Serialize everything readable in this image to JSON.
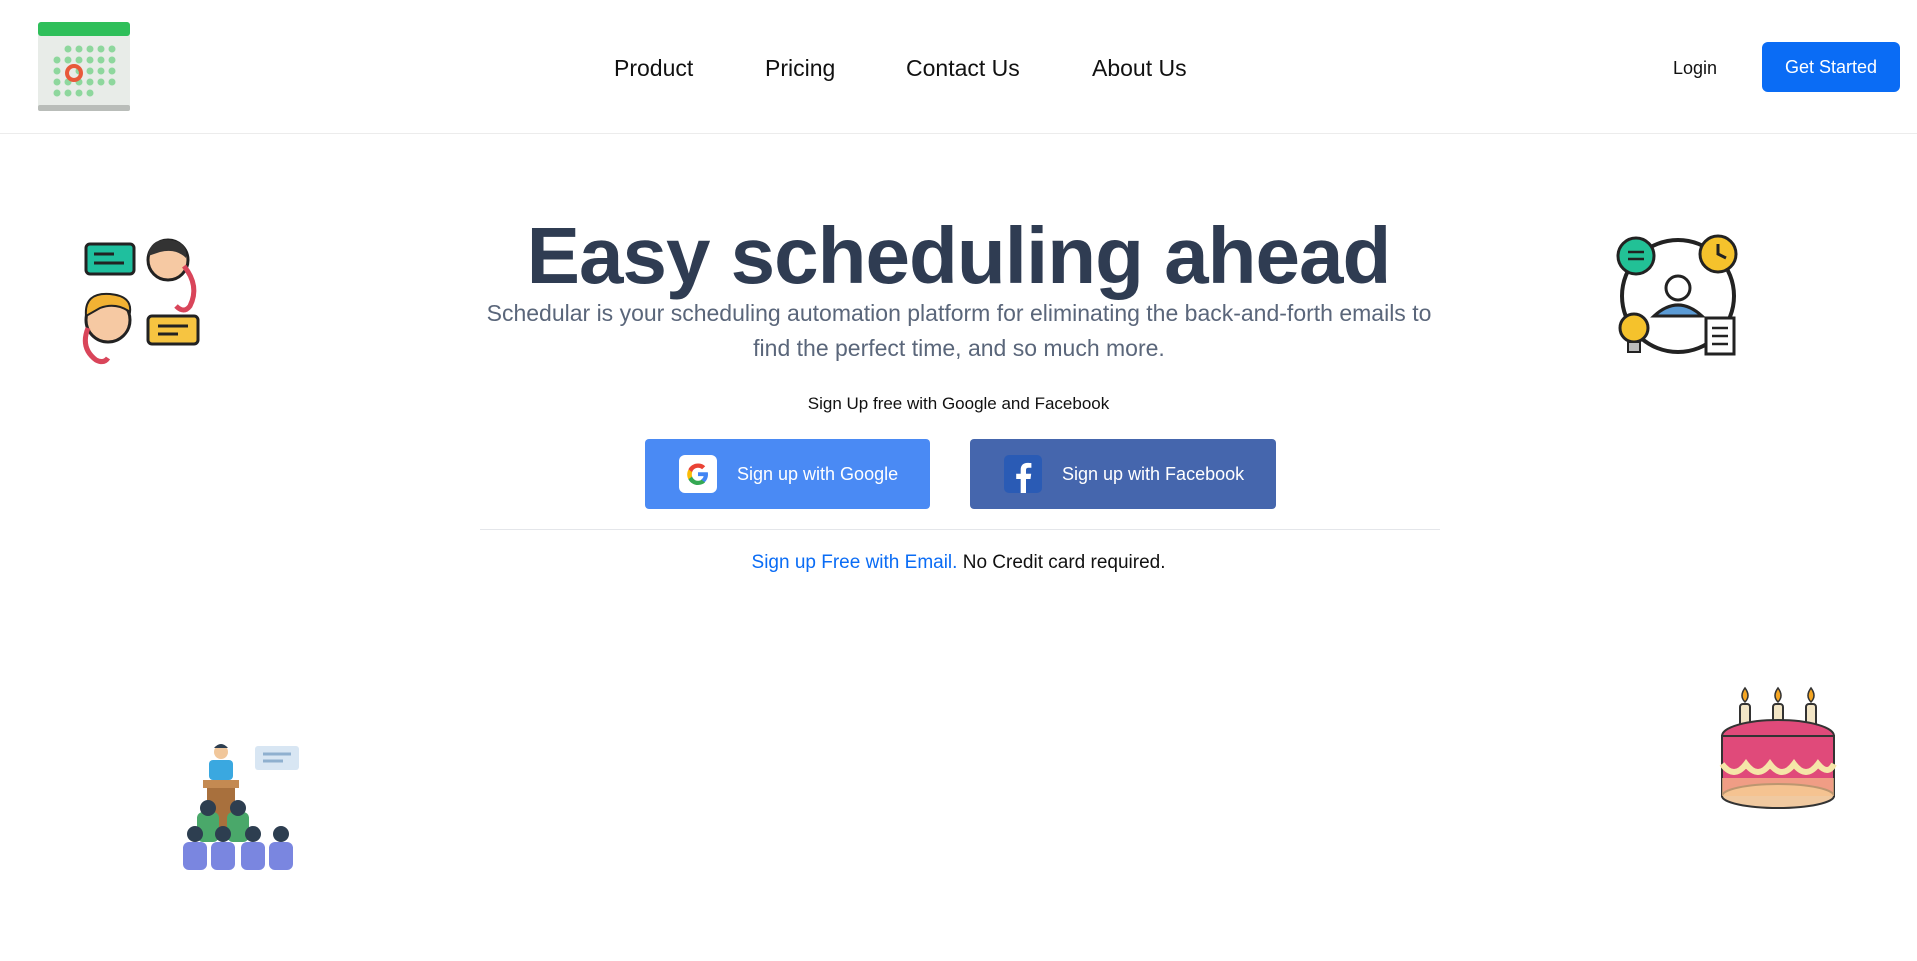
{
  "header": {
    "logo_icon": "calendar-icon",
    "nav": [
      {
        "label": "Product"
      },
      {
        "label": "Pricing"
      },
      {
        "label": "Contact Us"
      },
      {
        "label": "About Us"
      }
    ],
    "login_label": "Login",
    "get_started_label": "Get Started"
  },
  "hero": {
    "title": "Easy scheduling ahead",
    "subtitle": "Schedular is your scheduling automation platform for eliminating the back-and-forth emails to find the perfect time, and so much more.",
    "signup_caption": "Sign Up free with Google and Facebook",
    "google_button": "Sign up with Google",
    "facebook_button": "Sign up with Facebook",
    "email_link": "Sign up Free with Email.",
    "email_note": "No Credit card required."
  },
  "decorations": {
    "top_left": "chat-people-icon",
    "top_right": "user-network-icon",
    "bottom_left": "presentation-audience-icon",
    "bottom_right": "birthday-cake-icon"
  },
  "colors": {
    "primary": "#0a6cf5",
    "google": "#4a8af4",
    "facebook": "#4566ad",
    "title": "#2f3c52",
    "subtitle": "#5a667a"
  }
}
